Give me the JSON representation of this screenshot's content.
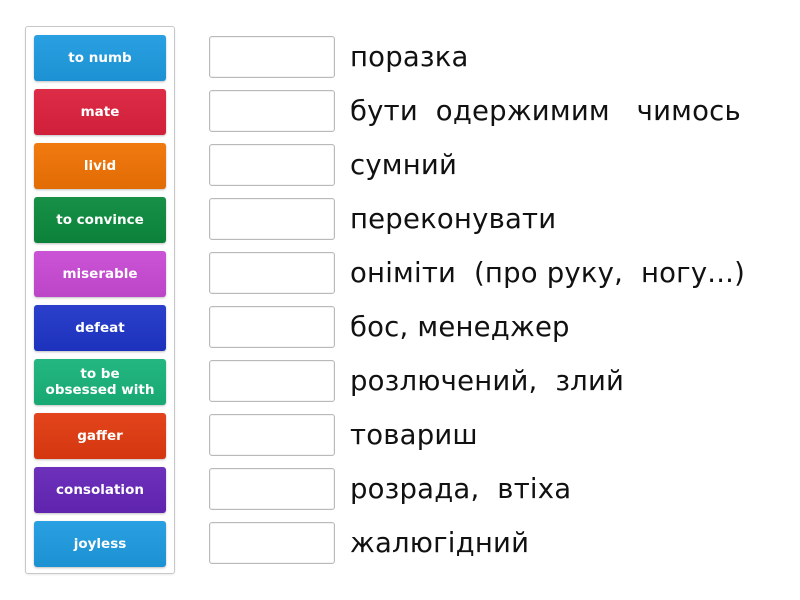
{
  "word_bank": {
    "tiles": [
      {
        "label": "to numb",
        "color": "#1e9be0"
      },
      {
        "label": "mate",
        "color": "#dc213d"
      },
      {
        "label": "livid",
        "color": "#f07304"
      },
      {
        "label": "to convince",
        "color": "#0c8a3d"
      },
      {
        "label": "miserable",
        "color": "#c84ad4"
      },
      {
        "label": "defeat",
        "color": "#1f35c8"
      },
      {
        "label": "to be obsessed with",
        "color": "#19b37a"
      },
      {
        "label": "gaffer",
        "color": "#e13a10"
      },
      {
        "label": "consolation",
        "color": "#6526b8"
      },
      {
        "label": "joyless",
        "color": "#1e9be0"
      }
    ]
  },
  "targets": {
    "rows": [
      {
        "slot_value": "",
        "term": "поразка"
      },
      {
        "slot_value": "",
        "term": "бути  одержимим   чимось"
      },
      {
        "slot_value": "",
        "term": "сумний"
      },
      {
        "slot_value": "",
        "term": "переконувати"
      },
      {
        "slot_value": "",
        "term": "оніміти  (про руку,  ногу...)"
      },
      {
        "slot_value": "",
        "term": "бос, менеджер"
      },
      {
        "slot_value": "",
        "term": "розлючений,  злий"
      },
      {
        "slot_value": "",
        "term": "товариш"
      },
      {
        "slot_value": "",
        "term": "розрада,  втіха"
      },
      {
        "slot_value": "",
        "term": "жалюгідний"
      }
    ]
  }
}
